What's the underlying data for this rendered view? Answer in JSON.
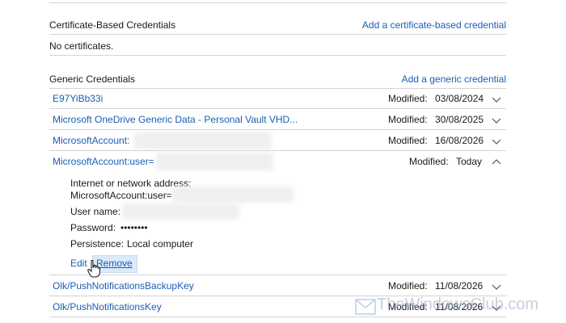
{
  "certificate_section": {
    "title": "Certificate-Based Credentials",
    "add_link": "Add a certificate-based credential",
    "empty_text": "No certificates."
  },
  "generic_section": {
    "title": "Generic Credentials",
    "add_link": "Add a generic credential",
    "items": [
      {
        "name": "E97YiBb33i",
        "modified_label": "Modified:",
        "modified_value": "03/08/2024"
      },
      {
        "name": "Microsoft OneDrive Generic Data - Personal Vault VHD...",
        "modified_label": "Modified:",
        "modified_value": "30/08/2025"
      },
      {
        "name": "MicrosoftAccount:",
        "modified_label": "Modified:",
        "modified_value": "16/08/2026"
      },
      {
        "name": "MicrosoftAccount:user=",
        "modified_label": "Modified:",
        "modified_value": "Today"
      },
      {
        "name": "Olk/PushNotificationsBackupKey",
        "modified_label": "Modified:",
        "modified_value": "11/08/2026"
      },
      {
        "name": "Olk/PushNotificationsKey",
        "modified_label": "Modified:",
        "modified_value": "11/08/2026"
      }
    ],
    "expanded_details": {
      "address_label": "Internet or network address:",
      "address_value": "MicrosoftAccount:user=",
      "username_label": "User name:",
      "password_label": "Password:",
      "password_value": "••••••••",
      "persistence_label": "Persistence:",
      "persistence_value": "Local computer",
      "edit_label": "Edit",
      "remove_label": "Remove"
    }
  },
  "watermark": {
    "text": "TheWindowsClub.com"
  },
  "colors": {
    "link": "#1a5fb4",
    "divider": "#d4d4d4",
    "button_hover": "#dceaf8"
  }
}
